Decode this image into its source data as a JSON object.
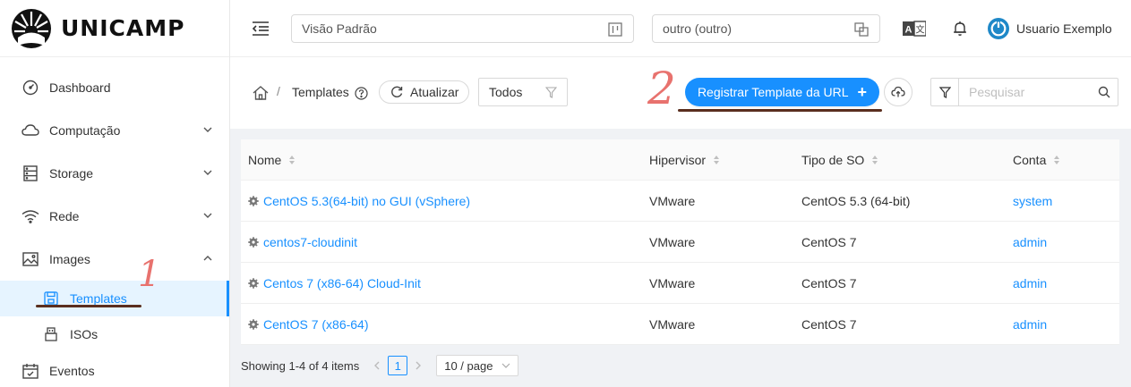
{
  "brand": {
    "name": "UNICAMP"
  },
  "sidebar": {
    "items": [
      {
        "label": "Dashboard",
        "icon": "dashboard-icon"
      },
      {
        "label": "Computação",
        "icon": "cloud-icon"
      },
      {
        "label": "Storage",
        "icon": "database-icon"
      },
      {
        "label": "Rede",
        "icon": "wifi-icon"
      },
      {
        "label": "Images",
        "icon": "picture-icon"
      },
      {
        "label": "Eventos",
        "icon": "schedule-icon"
      }
    ],
    "sub_items": [
      {
        "label": "Templates",
        "icon": "save-icon",
        "active": true
      },
      {
        "label": "ISOs",
        "icon": "usb-icon"
      }
    ]
  },
  "header": {
    "view_select": "Visão Padrão",
    "project_select": "outro (outro)",
    "user_name": "Usuario Exemplo"
  },
  "toolbar": {
    "breadcrumb_current": "Templates",
    "refresh_label": "Atualizar",
    "filter_value": "Todos",
    "primary_label": "Registrar Template da URL",
    "search_placeholder": "Pesquisar"
  },
  "annotations": {
    "one": "1",
    "two": "2",
    "color": "#e8726e",
    "underline_color": "#5a2e1e"
  },
  "table": {
    "columns": [
      "Nome",
      "Hipervisor",
      "Tipo de SO",
      "Conta"
    ],
    "rows": [
      {
        "name": "CentOS 5.3(64-bit) no GUI (vSphere)",
        "hypervisor": "VMware",
        "os": "CentOS 5.3 (64-bit)",
        "account": "system"
      },
      {
        "name": "centos7-cloudinit",
        "hypervisor": "VMware",
        "os": "CentOS 7",
        "account": "admin"
      },
      {
        "name": "Centos 7 (x86-64) Cloud-Init",
        "hypervisor": "VMware",
        "os": "CentOS 7",
        "account": "admin"
      },
      {
        "name": "CentOS 7 (x86-64)",
        "hypervisor": "VMware",
        "os": "CentOS 7",
        "account": "admin"
      }
    ]
  },
  "pagination": {
    "summary": "Showing 1-4 of 4 items",
    "current_page": "1",
    "page_size": "10 / page"
  },
  "colors": {
    "accent": "#1890ff",
    "active_bg": "#e6f4ff"
  }
}
